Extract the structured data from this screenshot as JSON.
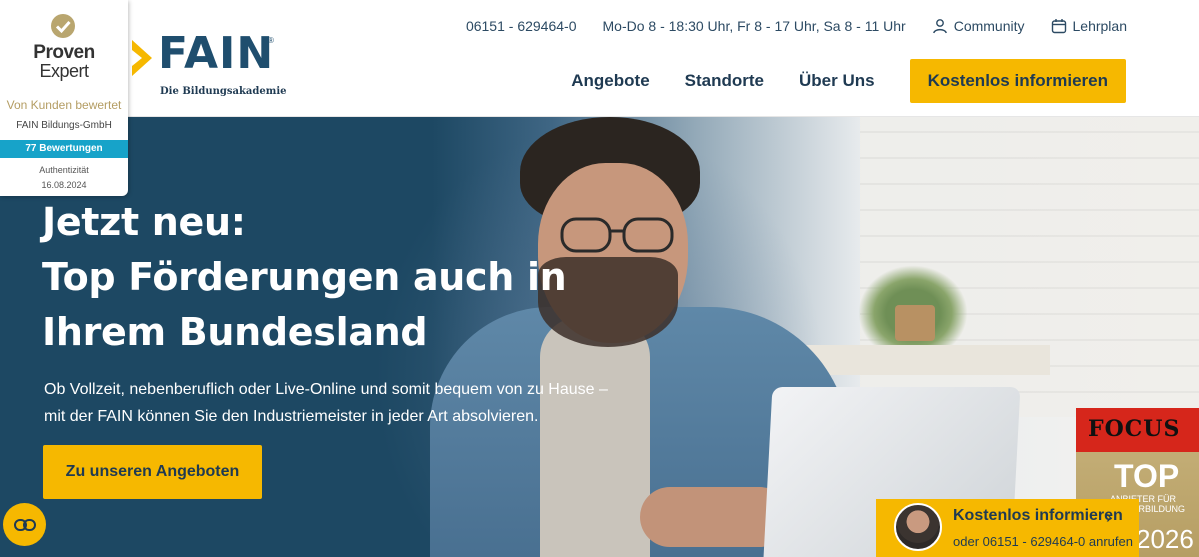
{
  "header": {
    "logo": {
      "name": "FAIN",
      "registered": "®",
      "tagline": "Die Bildungsakademie"
    },
    "topbar": {
      "phone": "06151 - 629464-0",
      "hours": "Mo-Do 8 - 18:30 Uhr, Fr 8 - 17 Uhr, Sa 8 - 11 Uhr",
      "community_label": "Community",
      "community_icon": "user-icon",
      "curriculum_label": "Lehrplan",
      "curriculum_icon": "calendar-icon"
    },
    "nav": {
      "items": [
        "Angebote",
        "Standorte",
        "Über Uns"
      ],
      "cta_label": "Kostenlos informieren"
    }
  },
  "proven_expert": {
    "brand_line1": "Proven",
    "brand_line2": "Expert",
    "rated_text": "Von Kunden bewertet",
    "company": "FAIN Bildungs-GmbH",
    "reviews": "77 Bewertungen",
    "authenticity_label": "Authentizität",
    "date": "16.08.2024"
  },
  "hero": {
    "title_lines": [
      "Jetzt neu:",
      "Top Förderungen auch in",
      "Ihrem Bundesland"
    ],
    "text_lines": [
      "Ob Vollzeit, nebenberuflich oder Live-Online und somit bequem von zu Hause –",
      "mit der FAIN können Sie den Industriemeister in jeder Art absolvieren."
    ],
    "button_label": "Zu unseren Angeboten"
  },
  "focus_badge": {
    "logo": "FOCUS",
    "title": "TOP",
    "small_text": "ANBIETER FÜR WEITERBILDUNG",
    "year": "2026"
  },
  "sticky_contact": {
    "title": "Kostenlos informieren",
    "chevron": "›",
    "subtitle": "oder 06151 - 629464-0 anrufen"
  },
  "cookie_button": {
    "icon": "cookie-consent-icon"
  },
  "colors": {
    "brand_blue": "#1f4e6e",
    "accent_yellow": "#f6b800",
    "hero_blue": "#1d4863",
    "proven_gold": "#b49d63",
    "proven_teal": "#17a3c9",
    "focus_red": "#d6261b"
  }
}
